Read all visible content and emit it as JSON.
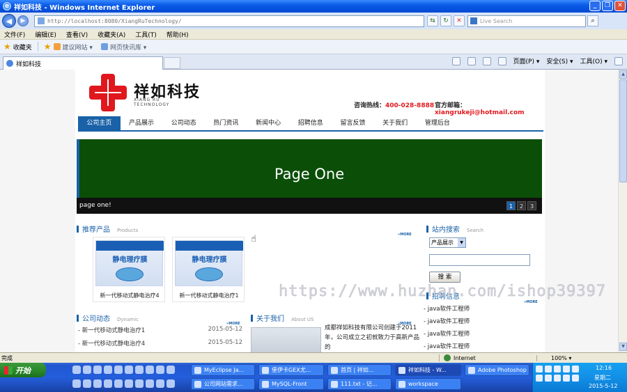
{
  "window": {
    "title": "祥如科技 - Windows Internet Explorer",
    "address": "http://localhost:8080/XiangRuTechnology/",
    "search_placeholder": "Live Search"
  },
  "menu": [
    "文件(F)",
    "编辑(E)",
    "查看(V)",
    "收藏夹(A)",
    "工具(T)",
    "帮助(H)"
  ],
  "favorites": {
    "label": "收藏夹",
    "links": [
      "建议网站 ▾",
      "网页快讯库 ▾"
    ]
  },
  "tab": {
    "label": "祥如科技"
  },
  "commands": [
    "页面(P) ▾",
    "安全(S) ▾",
    "工具(O) ▾"
  ],
  "site": {
    "brand_cn": "祥如科技",
    "brand_en_1": "XIANG RU",
    "brand_en_2": "TECHNOLOGY",
    "hotline_label": "咨询热线：",
    "hotline": "400-028-8888",
    "email_label": "官方邮箱：",
    "email": "xiangrukeji@hotmail.com",
    "nav": [
      "公司主页",
      "产品展示",
      "公司动态",
      "热门资讯",
      "新闻中心",
      "招聘信息",
      "留言反馈",
      "关于我们",
      "管理后台"
    ],
    "banner": {
      "title": "Page One",
      "caption": "page one!",
      "pages": [
        "1",
        "2",
        "3"
      ]
    },
    "products_section": {
      "title": "推荐产品",
      "en": "Products",
      "more": "»MORE"
    },
    "products": [
      {
        "name": "静电理疗膜",
        "caption": "新一代移动式静电治疗4"
      },
      {
        "name": "静电理疗膜",
        "caption": "新一代移动式静电治疗1"
      }
    ],
    "search_section": {
      "title": "站内搜索",
      "en": "Search"
    },
    "search_select": "产品展示",
    "search_button": "搜 索",
    "jobs_section": {
      "title": "招聘信息",
      "more": "»MORE"
    },
    "jobs": [
      "- java软件工程师",
      "- java软件工程师",
      "- java软件工程师",
      "- java软件工程师"
    ],
    "news_section": {
      "title": "公司动态",
      "en": "Dynamic",
      "more": "»MORE"
    },
    "news": [
      {
        "title": "- 新一代移动式静电治疗1",
        "date": "2015-05-12"
      },
      {
        "title": "- 新一代移动式静电治疗4",
        "date": "2015-05-12"
      }
    ],
    "about_section": {
      "title": "关于我们",
      "en": "About US",
      "more": "»MORE"
    },
    "about_text": "成都祥如科技有限公司创建于2011年，公司成立之初就致力于高新产品的"
  },
  "watermark": "https://www.huzhan.com/ishop39397",
  "status": {
    "left": "完成",
    "zone": "Internet",
    "zoom": "100% ▾"
  },
  "taskbar": {
    "start": "开始",
    "row1": [
      "MyEclipse Ja...",
      "堡伊卡GEX尤...",
      "首页 | 祥如...",
      "祥如科技 - W...",
      "Adobe Photoshop"
    ],
    "row2": [
      "公司网站需求...",
      "MySQL-Front",
      "111.txt - 记...",
      "workspace"
    ],
    "time": "12:16",
    "day": "星期二",
    "date": "2015-5-12"
  }
}
